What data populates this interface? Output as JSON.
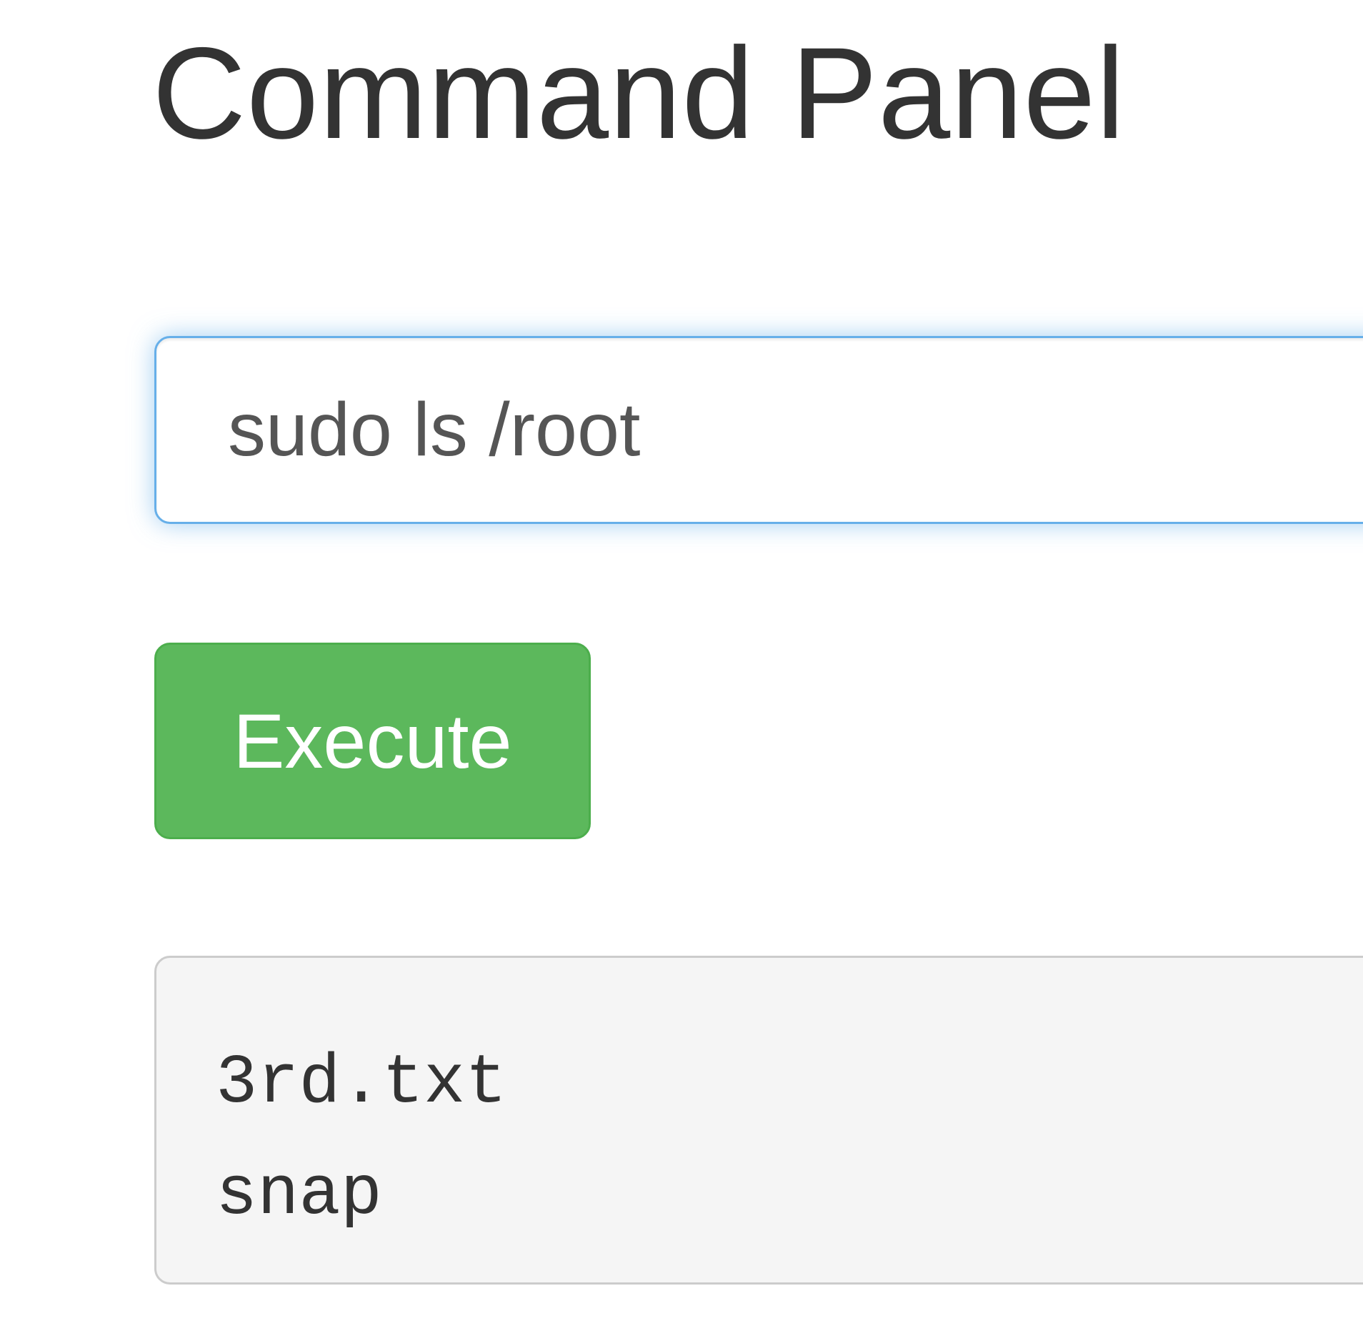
{
  "header": {
    "title": "Command Panel"
  },
  "command": {
    "value": "sudo ls /root",
    "placeholder": ""
  },
  "actions": {
    "execute_label": "Execute"
  },
  "output": {
    "lines": [
      "3rd.txt",
      "snap"
    ]
  },
  "colors": {
    "accent_success": "#5cb85c",
    "focus_border": "#66afe9",
    "output_background": "#f5f5f5",
    "text": "#333333"
  }
}
